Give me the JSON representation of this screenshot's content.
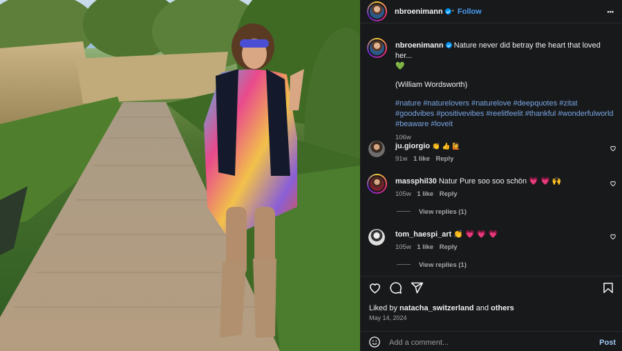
{
  "post": {
    "author": "nbroenimann",
    "follow_label": "Follow",
    "separator": "•",
    "more_label": "•••",
    "caption_author": "nbroenimann",
    "caption_text": "Nature never did betray the heart that loved her...",
    "caption_emoji": "💚",
    "caption_quote": "(William Wordsworth)",
    "hashtags": "#nature #naturelovers #naturelove #deepquotes #zitat #goodvibes #positivevibes #reelitfeelit #thankful #wonderfulworld #beaware #loveit",
    "caption_age": "106w"
  },
  "comments": [
    {
      "user": "ju.giorgio",
      "text": "👏 👍 🙋",
      "age": "91w",
      "likes": "1 like",
      "reply": "Reply",
      "view_replies": ""
    },
    {
      "user": "massphil30",
      "text": "Natur Pure soo soo schön 💗 💗 🙌",
      "age": "105w",
      "likes": "1 like",
      "reply": "Reply",
      "view_replies": "View replies (1)"
    },
    {
      "user": "tom_haespi_art",
      "text": "👏 💗 💗 💗",
      "age": "105w",
      "likes": "1 like",
      "reply": "Reply",
      "view_replies": "View replies (1)"
    }
  ],
  "engagement": {
    "liked_prefix": "Liked by",
    "liked_user": "natacha_switzerland",
    "liked_and": "and",
    "liked_others": "others",
    "date": "May 14, 2024"
  },
  "composer": {
    "placeholder": "Add a comment...",
    "post_label": "Post"
  },
  "icons": {
    "heart": "heart-icon",
    "comment": "comment-icon",
    "share": "share-icon",
    "save": "bookmark-icon",
    "emoji": "emoji-icon",
    "more": "more-icon"
  },
  "colors": {
    "accent": "#0095f6",
    "link": "#7aa7e6",
    "panel": "#18191b"
  }
}
